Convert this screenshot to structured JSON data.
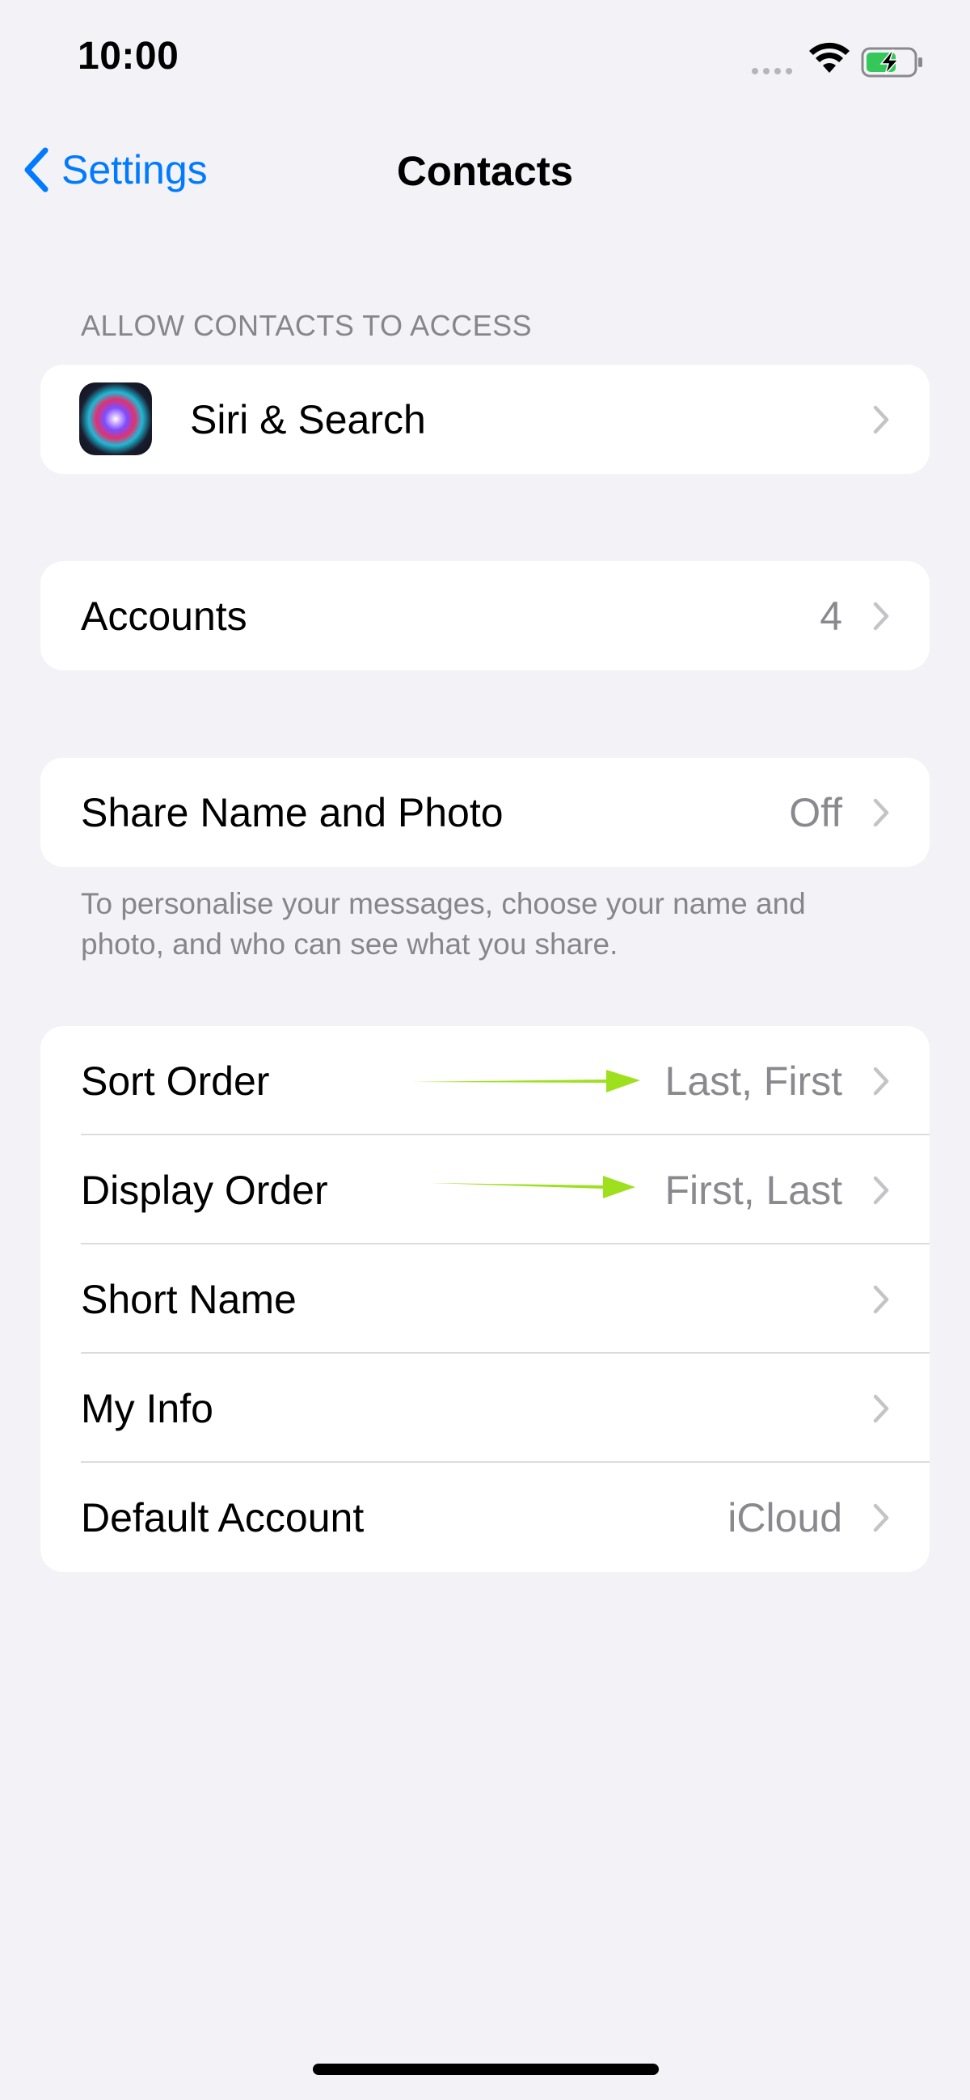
{
  "status_bar": {
    "time": "10:00"
  },
  "nav": {
    "back_label": "Settings",
    "title": "Contacts"
  },
  "allow_section": {
    "header": "ALLOW CONTACTS TO ACCESS",
    "items": [
      {
        "label": "Siri & Search",
        "icon": "siri-icon"
      }
    ]
  },
  "accounts_group": {
    "label": "Accounts",
    "value": "4"
  },
  "share_group": {
    "label": "Share Name and Photo",
    "value": "Off",
    "footer": "To personalise your messages, choose your name and photo, and who can see what you share."
  },
  "contact_settings": {
    "items": [
      {
        "label": "Sort Order",
        "value": "Last, First"
      },
      {
        "label": "Display Order",
        "value": "First, Last"
      },
      {
        "label": "Short Name",
        "value": ""
      },
      {
        "label": "My Info",
        "value": ""
      },
      {
        "label": "Default Account",
        "value": "iCloud"
      }
    ]
  },
  "colors": {
    "accent": "#007aff",
    "background": "#f2f2f7",
    "secondary_text": "#8a8a8e",
    "annotation_arrow": "#9ee01e",
    "battery_fill": "#34c759"
  }
}
